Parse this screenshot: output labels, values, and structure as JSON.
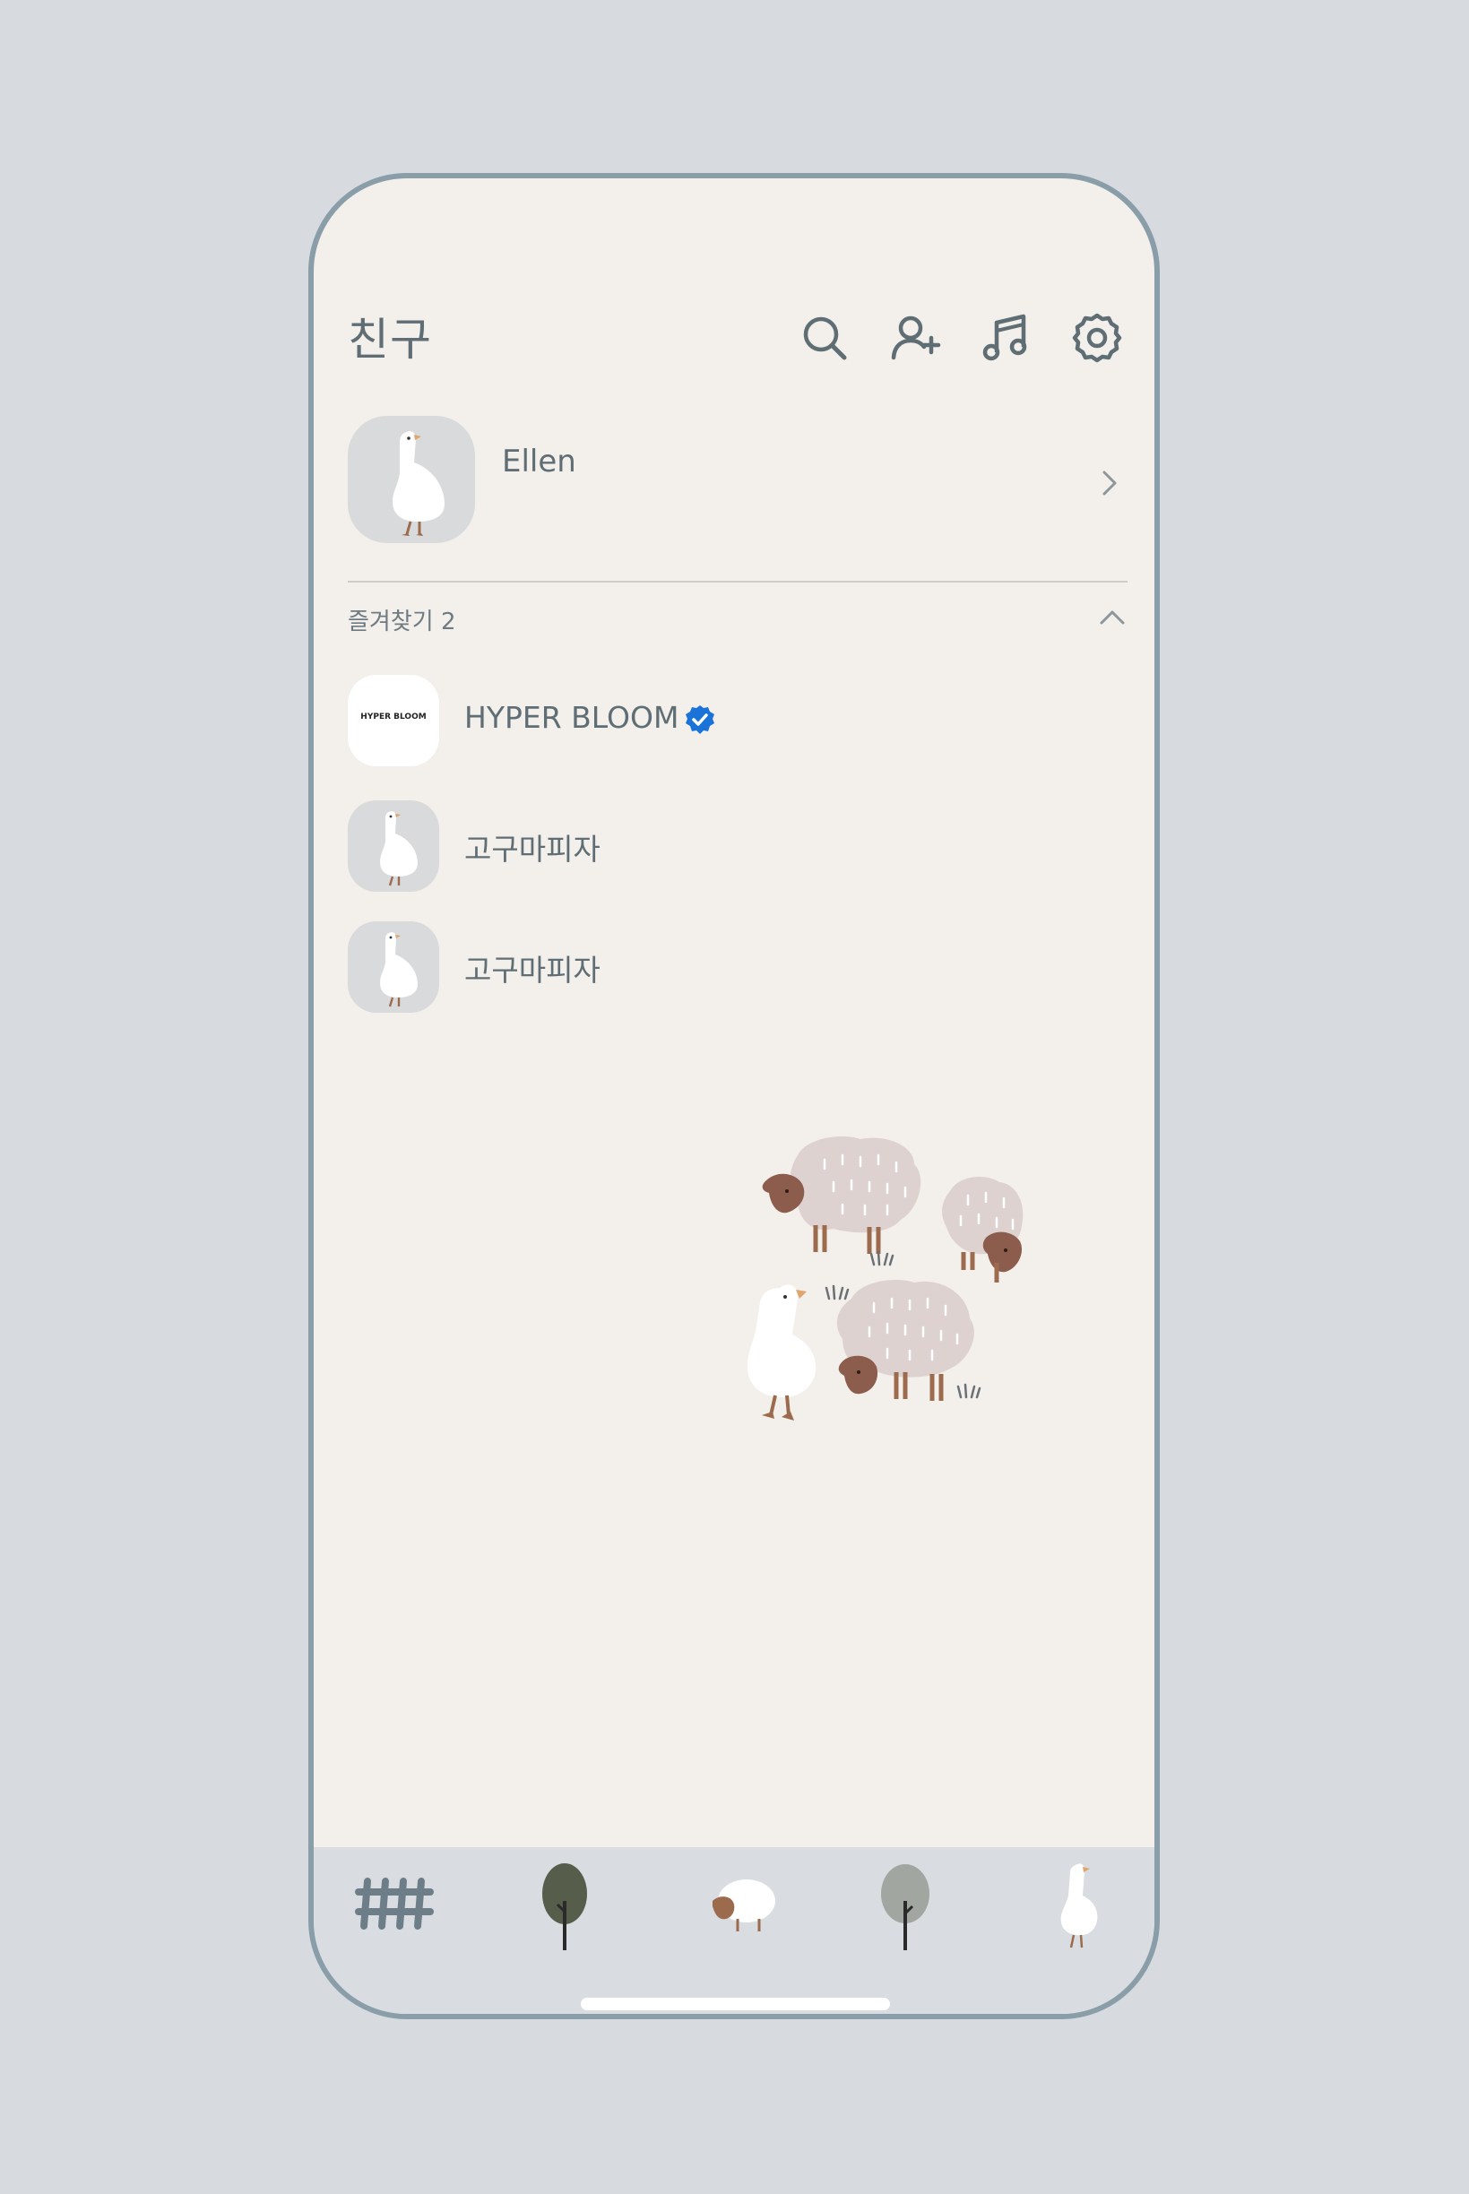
{
  "header": {
    "title": "친구",
    "icons": [
      "search-icon",
      "add-friend-icon",
      "music-icon",
      "settings-icon"
    ]
  },
  "profile": {
    "name": "Ellen",
    "avatar": "goose-avatar"
  },
  "favorites": {
    "label": "즐겨찾기 2",
    "items": [
      {
        "name": "HYPER BLOOM",
        "logo_text": "HYPER BLOOM",
        "verified": true
      },
      {
        "name": "고구마피자",
        "avatar": "goose-avatar"
      },
      {
        "name": "고구마피자",
        "avatar": "goose-avatar"
      }
    ]
  },
  "tabs": [
    {
      "icon": "fence-icon"
    },
    {
      "icon": "dark-tree-icon"
    },
    {
      "icon": "sheep-icon"
    },
    {
      "icon": "grey-tree-icon"
    },
    {
      "icon": "goose-icon"
    }
  ],
  "colors": {
    "background": "#d7dbdf",
    "screen": "#f3efea",
    "frame": "#8a9ea9",
    "text": "#5f6d74",
    "tabbar": "#d9dde1",
    "verified": "#1a73d9"
  }
}
